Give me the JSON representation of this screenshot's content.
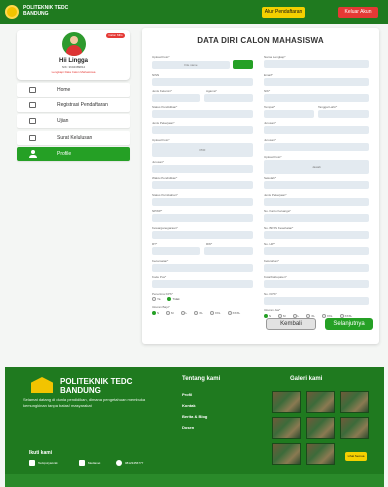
{
  "header": {
    "brand": "POLITEKNIK TEDC BANDUNG",
    "alur_label": "Alur Pendaftaran",
    "keluar_label": "Keluar Akun"
  },
  "profile": {
    "badge": "Calon Mhs",
    "name": "Hii Lingga",
    "nik": "NIK: 3604389812",
    "link": "Lengkapi Data Calon Mahasiswa"
  },
  "sidebar": {
    "items": [
      {
        "label": "Home",
        "icon": "home-icon"
      },
      {
        "label": "Registrasi Pendaftaran",
        "icon": "clipboard-icon"
      },
      {
        "label": "Ujian",
        "icon": "exam-icon"
      },
      {
        "label": "Surat Kelulusan",
        "icon": "certificate-icon"
      },
      {
        "label": "Profile",
        "icon": "user-icon"
      }
    ]
  },
  "form": {
    "title": "DATA DIRI CALON MAHASISWA",
    "left": {
      "foto": "Upload Foto*",
      "foto_value": "File name",
      "nisn": "NISN",
      "agama": "Jenis Kelamin*",
      "agama2": "Agama*",
      "status": "Status Pendidikan*",
      "jurusan": "Jenis Pekerjaan*",
      "ijazah": "Upload Foto*",
      "ijazah_value": "PDF",
      "jurusan2": "Jurusan*",
      "waktu": "Waktu Pendidikan*",
      "status_perkawinan": "Status Pernikahan*",
      "npwp": "NPWP*",
      "kewarganegaraan": "Kewarganegaraan*",
      "rt": "RT*",
      "rw": "RW*",
      "kelurahan": "Kecamatan*",
      "kodepos": "Kode Pos*",
      "penerima_kps": "Penerima KPS*",
      "kps_ya": "Ya",
      "kps_tidak": "Tidak",
      "ukuran_baju": "Ukuran Baju*"
    },
    "right": {
      "nama": "Nama Lengkap*",
      "email": "Email*",
      "nik": "NIK*",
      "tempat": "Tempat*",
      "tanggal": "Tanggal Lahir*",
      "jurusan": "Jurusan*",
      "jurusan2": "Jurusan*",
      "ijazah": "Upload Foto*",
      "ijazah_value": "Jawab",
      "sekolah": "Sekolah*",
      "jenis": "Jenis Pekerjaan*",
      "kk": "No. Kartu Keluarga*",
      "bpjs": "No. BPJS Kesehatan*",
      "hp": "No. HP*",
      "kelurahan": "Kelurahan*",
      "kota": "Kota/Kabupaten*",
      "kps": "No. KPS*",
      "ukuran_jas": "Ukuran Jas*"
    },
    "sizes": [
      "S",
      "M",
      "L",
      "XL",
      "XXL",
      "XXXL"
    ],
    "kembali": "Kembali",
    "selanjutnya": "Selanjutnya"
  },
  "footer": {
    "brand": "POLITEKNIK TEDC BANDUNG",
    "desc": "Selamat datang di dunia pendidikan, dimana pengetahuan membuka kemungkinan tanpa batas! masyarakat",
    "tentang": "Tentang kami",
    "links": [
      "Profil",
      "Kontak",
      "Berita & Blog",
      "Dosen"
    ],
    "galeri": "Galeri kami",
    "more": "Lihat Semua",
    "ikuti": "Ikuti kami",
    "social": [
      "Tedcpolyteknik",
      "Medianet",
      "08123456777"
    ]
  }
}
